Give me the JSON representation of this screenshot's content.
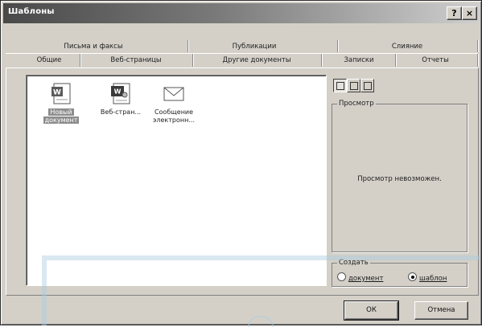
{
  "window": {
    "title": "Шаблоны",
    "help_btn": "?",
    "close_btn": "×"
  },
  "tabs": {
    "back_row": [
      "Письма и факсы",
      "Публикации",
      "Слияние"
    ],
    "front_row": [
      "Общие",
      "Веб-страницы",
      "Другие документы",
      "Записки",
      "Отчеты"
    ],
    "active": "Общие"
  },
  "templates": [
    {
      "name": "Новый документ",
      "label_lines": [
        "Новый",
        "документ"
      ],
      "icon": "word-document-icon",
      "selected": true
    },
    {
      "name": "Веб-страница",
      "label_lines": [
        "Веб-стран..."
      ],
      "icon": "web-page-icon",
      "selected": false
    },
    {
      "name": "Сообщение электронной почты",
      "label_lines": [
        "Сообщение",
        "электронн..."
      ],
      "icon": "envelope-icon",
      "selected": false
    }
  ],
  "view_buttons": [
    "large-icons-view-icon",
    "list-view-icon",
    "details-view-icon"
  ],
  "preview": {
    "legend": "Просмотр",
    "message": "Просмотр невозможен."
  },
  "create": {
    "legend": "Создать",
    "options": [
      {
        "label": "документ",
        "checked": false
      },
      {
        "label": "шаблон",
        "checked": true
      }
    ]
  },
  "buttons": {
    "ok": "ОК",
    "cancel": "Отмена"
  },
  "colors": {
    "dialog_bg": "#d4d0c8",
    "selection": "#8c8c8c",
    "overlay": "#aacde1"
  }
}
